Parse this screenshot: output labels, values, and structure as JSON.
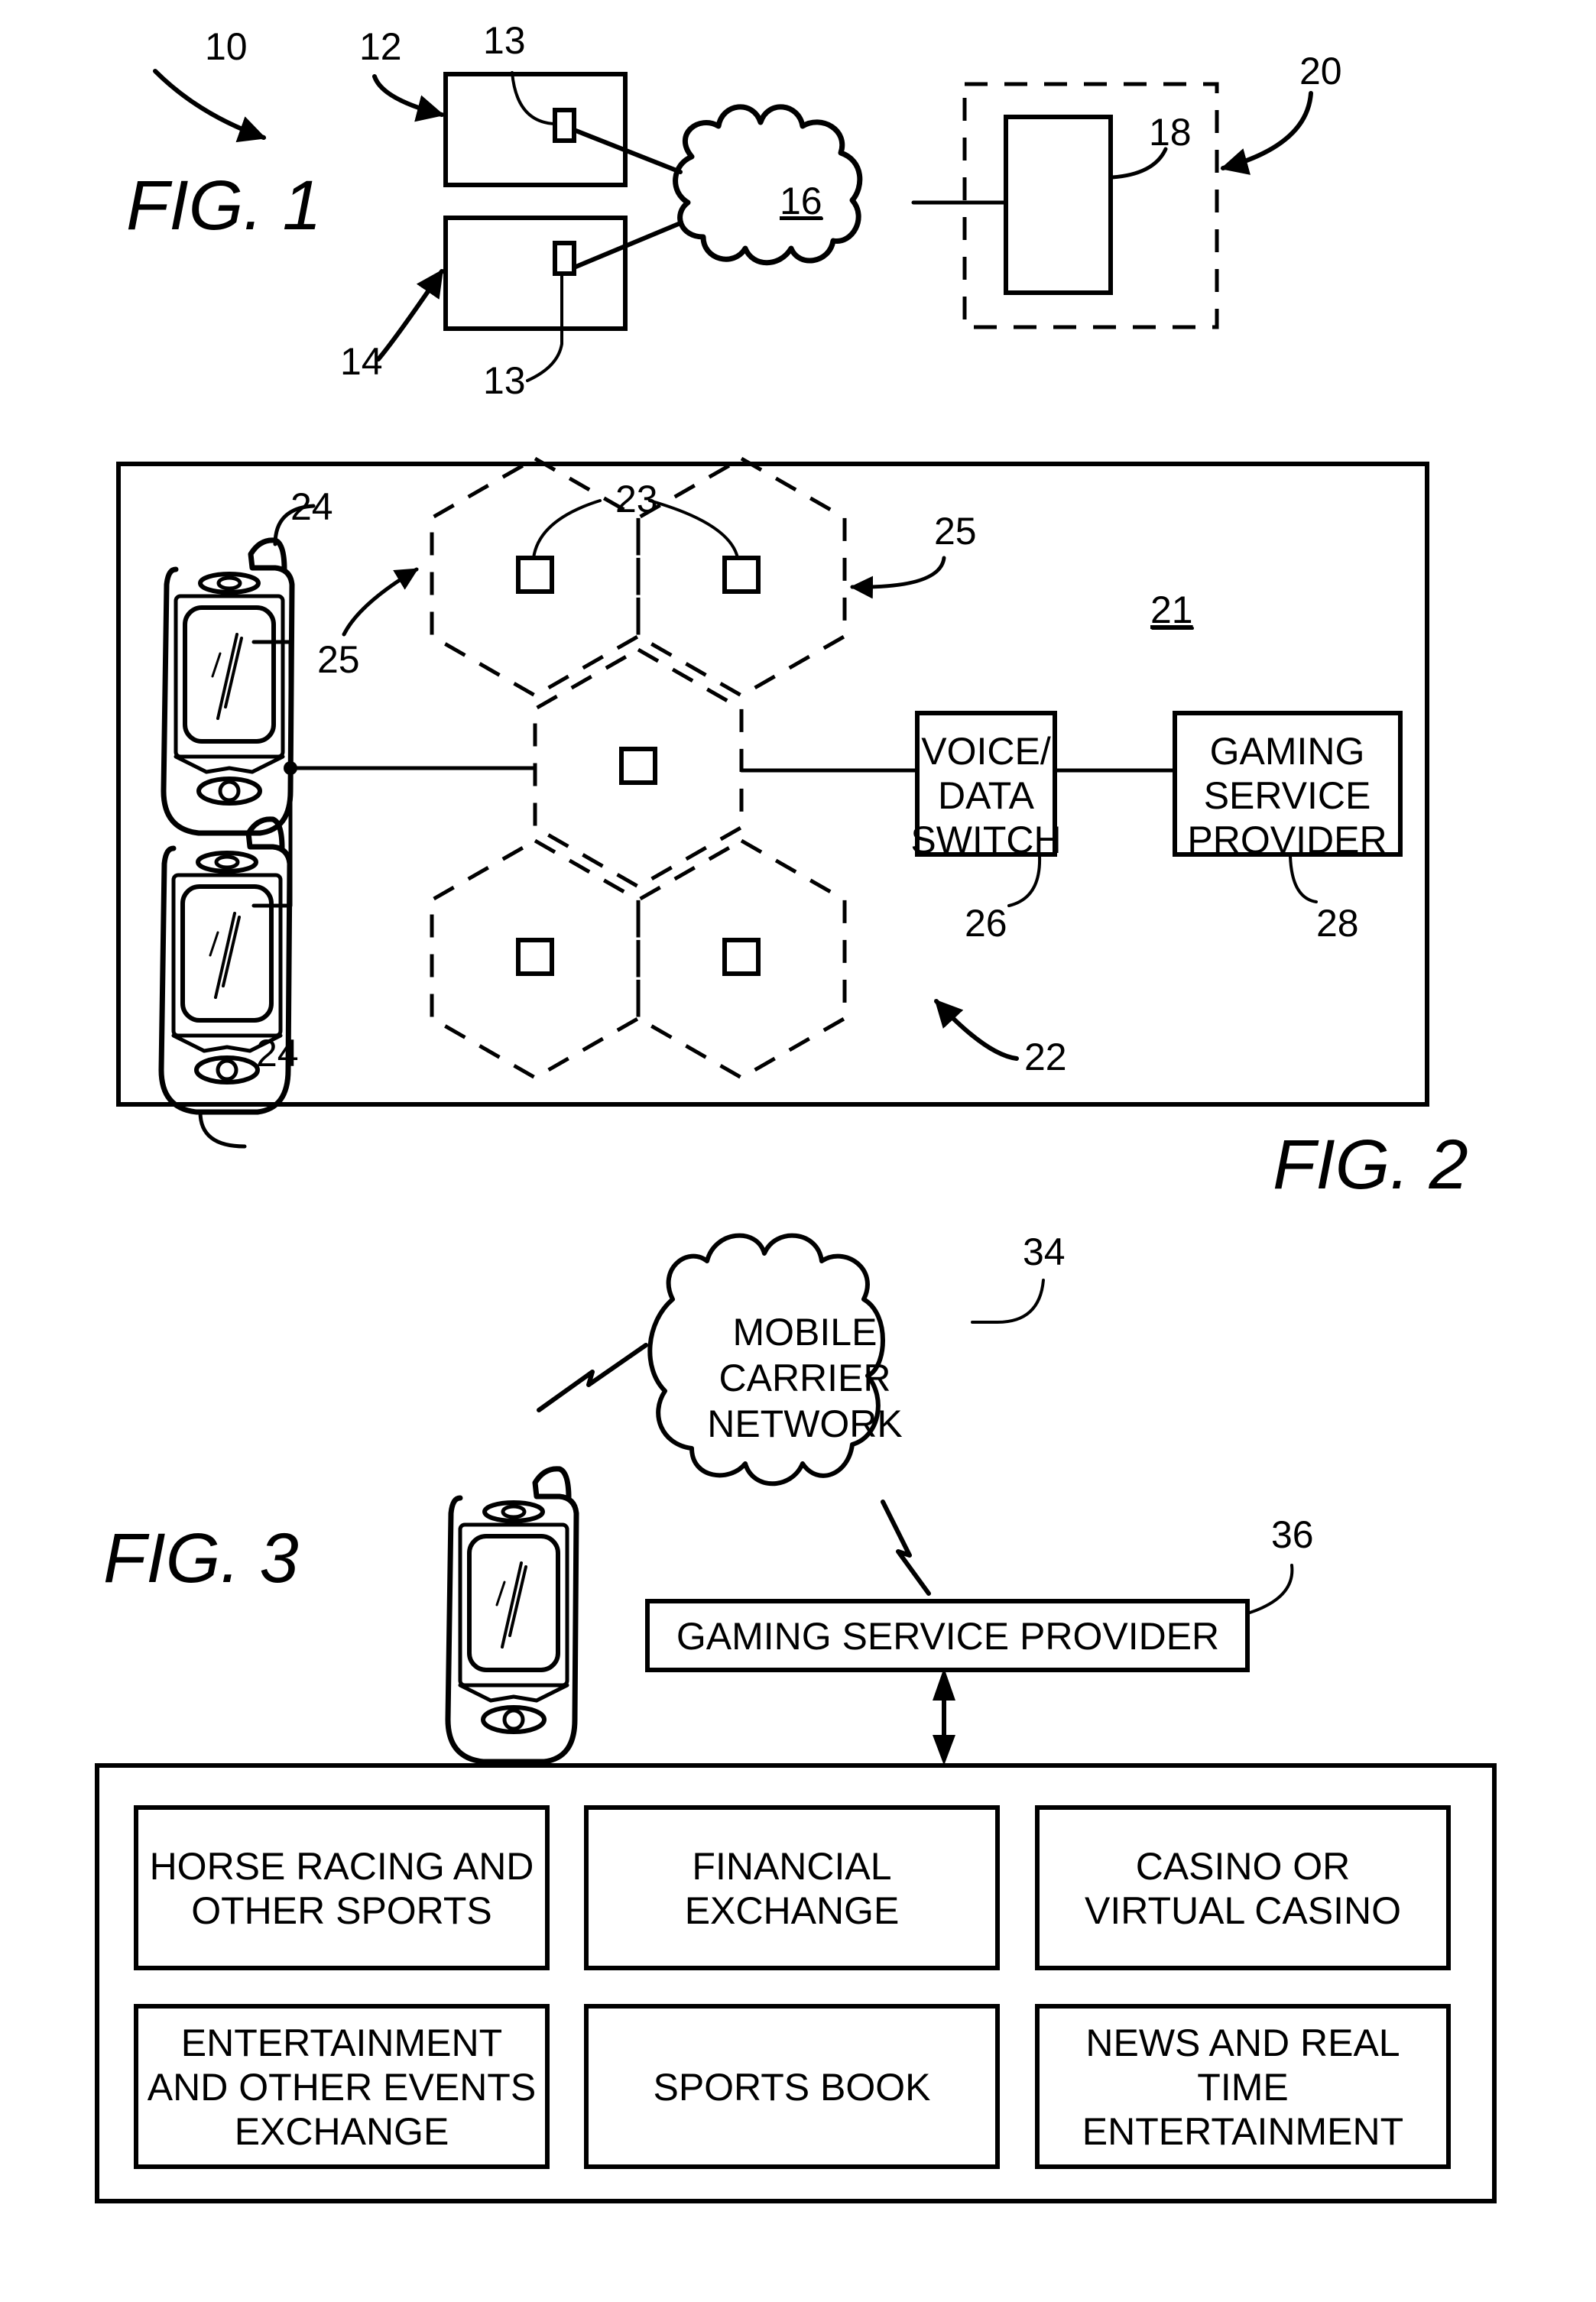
{
  "fig1": {
    "title": "FIG. 1",
    "ref_system": "10",
    "ref_terminal_top": "12",
    "ref_terminal_bottom": "14",
    "ref_module_top": "13",
    "ref_module_bottom": "13",
    "ref_network": "16",
    "ref_server": "18",
    "ref_server_group": "20"
  },
  "fig2": {
    "title": "FIG. 2",
    "ref_system": "21",
    "ref_cellular_network": "22",
    "ref_base_stations": "23",
    "ref_mobile_top": "24",
    "ref_mobile_bottom": "24",
    "ref_cell_left": "25",
    "ref_cell_right": "25",
    "ref_switch": "26",
    "ref_provider": "28",
    "switch_label": [
      "VOICE/",
      "DATA",
      "SWITCH"
    ],
    "provider_label": [
      "GAMING",
      "SERVICE",
      "PROVIDER"
    ]
  },
  "fig3": {
    "title": "FIG. 3",
    "ref_carrier": "34",
    "ref_provider": "36",
    "carrier_label": [
      "MOBILE",
      "CARRIER",
      "NETWORK"
    ],
    "provider_label": "GAMING SERVICE PROVIDER",
    "services": [
      {
        "lines": [
          "HORSE RACING AND",
          "OTHER SPORTS"
        ]
      },
      {
        "lines": [
          "FINANCIAL",
          "EXCHANGE"
        ]
      },
      {
        "lines": [
          "CASINO OR",
          "VIRTUAL CASINO"
        ]
      },
      {
        "lines": [
          "ENTERTAINMENT",
          "AND OTHER EVENTS",
          "EXCHANGE"
        ]
      },
      {
        "lines": [
          "SPORTS BOOK"
        ]
      },
      {
        "lines": [
          "NEWS AND REAL",
          "TIME",
          "ENTERTAINMENT"
        ]
      }
    ]
  }
}
